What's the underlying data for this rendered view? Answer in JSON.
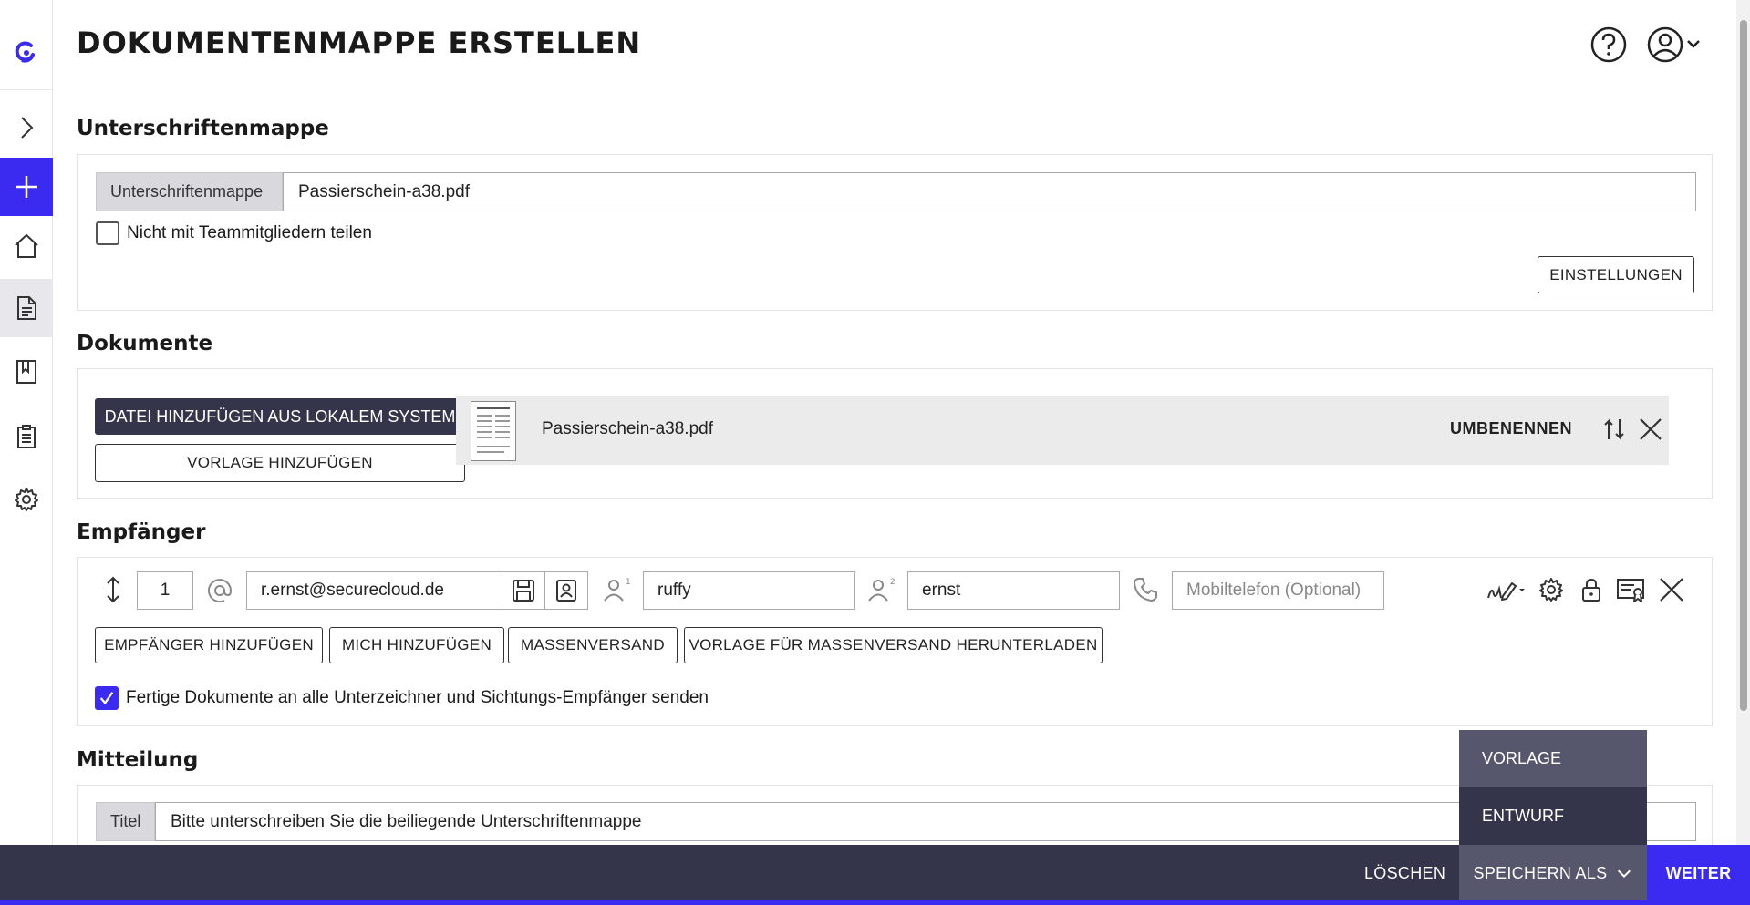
{
  "page": {
    "title": "DOKUMENTENMAPPE ERSTELLEN"
  },
  "colors": {
    "accent": "#3b2bf0",
    "dark": "#34344a",
    "dark_light": "#56566c"
  },
  "sidebar": {
    "items": [
      {
        "name": "logo",
        "icon": "logo-icon"
      },
      {
        "name": "expand",
        "icon": "chevron-right-icon"
      },
      {
        "name": "new",
        "icon": "plus-icon"
      },
      {
        "name": "home",
        "icon": "home-icon"
      },
      {
        "name": "documents",
        "icon": "document-icon"
      },
      {
        "name": "bookmarks",
        "icon": "bookmark-icon"
      },
      {
        "name": "clipboard",
        "icon": "clipboard-icon"
      },
      {
        "name": "settings",
        "icon": "gear-icon"
      }
    ]
  },
  "signature_folder": {
    "section_title": "Unterschriftenmappe",
    "field_label": "Unterschriftenmappe",
    "field_value": "Passierschein-a38.pdf",
    "no_share_label": "Nicht mit Teammitgliedern teilen",
    "no_share_checked": false,
    "settings_button": "EINSTELLUNGEN"
  },
  "documents": {
    "section_title": "Dokumente",
    "add_local_button": "DATEI HINZUFÜGEN AUS LOKALEM SYSTEM",
    "add_template_button": "VORLAGE HINZUFÜGEN",
    "files": [
      {
        "name": "Passierschein-a38.pdf",
        "rename_label": "UMBENENNEN"
      }
    ]
  },
  "recipients": {
    "section_title": "Empfänger",
    "rows": [
      {
        "order": "1",
        "email": "r.ernst@securecloud.de",
        "first_name": "ruffy",
        "last_name": "ernst",
        "phone_placeholder": "Mobiltelefon (Optional)"
      }
    ],
    "buttons": {
      "add_recipient": "EMPFÄNGER HINZUFÜGEN",
      "add_me": "MICH HINZUFÜGEN",
      "mass_send": "MASSENVERSAND",
      "mass_template": "VORLAGE FÜR MASSENVERSAND HERUNTERLADEN"
    },
    "send_all_label": "Fertige Dokumente an alle Unterzeichner und Sichtungs-Empfänger senden",
    "send_all_checked": true
  },
  "message": {
    "section_title": "Mitteilung",
    "title_label": "Titel",
    "title_value": "Bitte unterschreiben Sie die beiliegende Unterschriftenmappe"
  },
  "bottom_bar": {
    "delete_label": "LÖSCHEN",
    "save_as_label": "SPEICHERN ALS",
    "next_label": "WEITER"
  },
  "save_dropdown": {
    "items": [
      "VORLAGE",
      "ENTWURF"
    ],
    "highlighted": "VORLAGE"
  }
}
